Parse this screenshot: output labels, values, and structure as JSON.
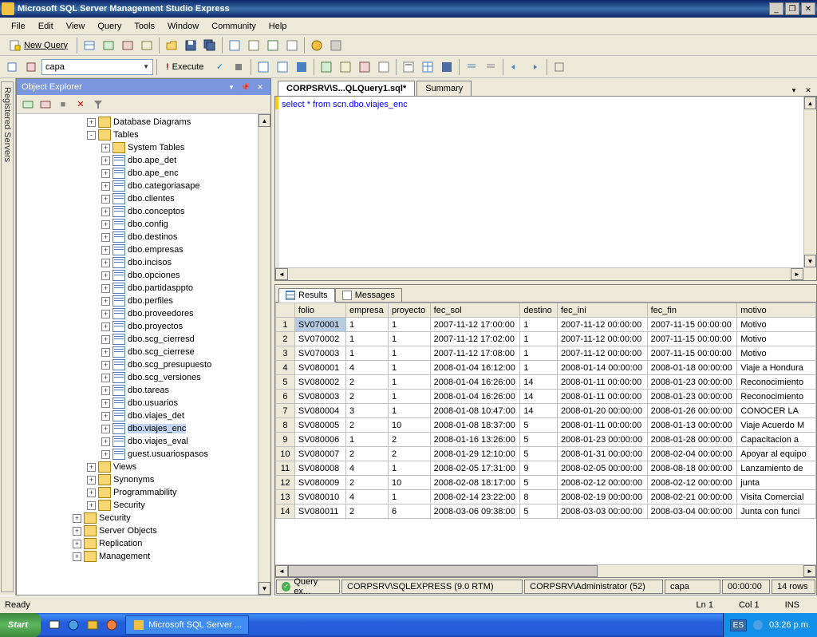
{
  "title": "Microsoft SQL Server Management Studio Express",
  "menu": [
    "File",
    "Edit",
    "View",
    "Query",
    "Tools",
    "Window",
    "Community",
    "Help"
  ],
  "newquery_label": "New Query",
  "db_combo": "capa",
  "execute_label": "Execute",
  "side_tab": "Registered Servers",
  "explorer_title": "Object Explorer",
  "tree": {
    "top": [
      {
        "label": "Database Diagrams",
        "kind": "folder",
        "toggle": "+",
        "ind": 2
      },
      {
        "label": "Tables",
        "kind": "folder",
        "toggle": "-",
        "ind": 2
      },
      {
        "label": "System Tables",
        "kind": "folder",
        "toggle": "+",
        "ind": 3
      },
      {
        "label": "dbo.ape_det",
        "kind": "table",
        "toggle": "+",
        "ind": 3
      },
      {
        "label": "dbo.ape_enc",
        "kind": "table",
        "toggle": "+",
        "ind": 3
      },
      {
        "label": "dbo.categoriasape",
        "kind": "table",
        "toggle": "+",
        "ind": 3
      },
      {
        "label": "dbo.clientes",
        "kind": "table",
        "toggle": "+",
        "ind": 3
      },
      {
        "label": "dbo.conceptos",
        "kind": "table",
        "toggle": "+",
        "ind": 3
      },
      {
        "label": "dbo.config",
        "kind": "table",
        "toggle": "+",
        "ind": 3
      },
      {
        "label": "dbo.destinos",
        "kind": "table",
        "toggle": "+",
        "ind": 3
      },
      {
        "label": "dbo.empresas",
        "kind": "table",
        "toggle": "+",
        "ind": 3
      },
      {
        "label": "dbo.incisos",
        "kind": "table",
        "toggle": "+",
        "ind": 3
      },
      {
        "label": "dbo.opciones",
        "kind": "table",
        "toggle": "+",
        "ind": 3
      },
      {
        "label": "dbo.partidasppto",
        "kind": "table",
        "toggle": "+",
        "ind": 3
      },
      {
        "label": "dbo.perfiles",
        "kind": "table",
        "toggle": "+",
        "ind": 3
      },
      {
        "label": "dbo.proveedores",
        "kind": "table",
        "toggle": "+",
        "ind": 3
      },
      {
        "label": "dbo.proyectos",
        "kind": "table",
        "toggle": "+",
        "ind": 3
      },
      {
        "label": "dbo.scg_cierresd",
        "kind": "table",
        "toggle": "+",
        "ind": 3
      },
      {
        "label": "dbo.scg_cierrese",
        "kind": "table",
        "toggle": "+",
        "ind": 3
      },
      {
        "label": "dbo.scg_presupuesto",
        "kind": "table",
        "toggle": "+",
        "ind": 3
      },
      {
        "label": "dbo.scg_versiones",
        "kind": "table",
        "toggle": "+",
        "ind": 3
      },
      {
        "label": "dbo.tareas",
        "kind": "table",
        "toggle": "+",
        "ind": 3
      },
      {
        "label": "dbo.usuarios",
        "kind": "table",
        "toggle": "+",
        "ind": 3
      },
      {
        "label": "dbo.viajes_det",
        "kind": "table",
        "toggle": "+",
        "ind": 3
      },
      {
        "label": "dbo.viajes_enc",
        "kind": "table",
        "toggle": "+",
        "ind": 3,
        "selected": true
      },
      {
        "label": "dbo.viajes_eval",
        "kind": "table",
        "toggle": "+",
        "ind": 3
      },
      {
        "label": "guest.usuariospasos",
        "kind": "table",
        "toggle": "+",
        "ind": 3
      },
      {
        "label": "Views",
        "kind": "folder",
        "toggle": "+",
        "ind": 2
      },
      {
        "label": "Synonyms",
        "kind": "folder",
        "toggle": "+",
        "ind": 2
      },
      {
        "label": "Programmability",
        "kind": "folder",
        "toggle": "+",
        "ind": 2
      },
      {
        "label": "Security",
        "kind": "folder",
        "toggle": "+",
        "ind": 2
      },
      {
        "label": "Security",
        "kind": "folder",
        "toggle": "+",
        "ind": 1
      },
      {
        "label": "Server Objects",
        "kind": "folder",
        "toggle": "+",
        "ind": 1
      },
      {
        "label": "Replication",
        "kind": "folder",
        "toggle": "+",
        "ind": 1
      },
      {
        "label": "Management",
        "kind": "folder",
        "toggle": "+",
        "ind": 1
      }
    ]
  },
  "tabs": {
    "active": "CORPSRV\\S...QLQuery1.sql*",
    "inactive": "Summary"
  },
  "sql": "select * from scn.dbo.viajes_enc",
  "results_tab": "Results",
  "messages_tab": "Messages",
  "columns": [
    "folio",
    "empresa",
    "proyecto",
    "fec_sol",
    "destino",
    "fec_ini",
    "fec_fin",
    "motivo"
  ],
  "rows": [
    [
      "SV070001",
      "1",
      "1",
      "2007-11-12 17:00:00",
      "1",
      "2007-11-12 00:00:00",
      "2007-11-15 00:00:00",
      "Motivo"
    ],
    [
      "SV070002",
      "1",
      "1",
      "2007-11-12 17:02:00",
      "1",
      "2007-11-12 00:00:00",
      "2007-11-15 00:00:00",
      "Motivo"
    ],
    [
      "SV070003",
      "1",
      "1",
      "2007-11-12 17:08:00",
      "1",
      "2007-11-12 00:00:00",
      "2007-11-15 00:00:00",
      "Motivo"
    ],
    [
      "SV080001",
      "4",
      "1",
      "2008-01-04 16:12:00",
      "1",
      "2008-01-14 00:00:00",
      "2008-01-18 00:00:00",
      "Viaje a Hondura"
    ],
    [
      "SV080002",
      "2",
      "1",
      "2008-01-04 16:26:00",
      "14",
      "2008-01-11 00:00:00",
      "2008-01-23 00:00:00",
      "Reconocimiento"
    ],
    [
      "SV080003",
      "2",
      "1",
      "2008-01-04 16:26:00",
      "14",
      "2008-01-11 00:00:00",
      "2008-01-23 00:00:00",
      "Reconocimiento"
    ],
    [
      "SV080004",
      "3",
      "1",
      "2008-01-08 10:47:00",
      "14",
      "2008-01-20 00:00:00",
      "2008-01-26 00:00:00",
      "CONOCER LA"
    ],
    [
      "SV080005",
      "2",
      "10",
      "2008-01-08 18:37:00",
      "5",
      "2008-01-11 00:00:00",
      "2008-01-13 00:00:00",
      "Viaje Acuerdo M"
    ],
    [
      "SV080006",
      "1",
      "2",
      "2008-01-16 13:26:00",
      "5",
      "2008-01-23 00:00:00",
      "2008-01-28 00:00:00",
      "Capacitacion a"
    ],
    [
      "SV080007",
      "2",
      "2",
      "2008-01-29 12:10:00",
      "5",
      "2008-01-31 00:00:00",
      "2008-02-04 00:00:00",
      "Apoyar al equipo"
    ],
    [
      "SV080008",
      "4",
      "1",
      "2008-02-05 17:31:00",
      "9",
      "2008-02-05 00:00:00",
      "2008-08-18 00:00:00",
      "Lanzamiento de"
    ],
    [
      "SV080009",
      "2",
      "10",
      "2008-02-08 18:17:00",
      "5",
      "2008-02-12 00:00:00",
      "2008-02-12 00:00:00",
      "junta"
    ],
    [
      "SV080010",
      "4",
      "1",
      "2008-02-14 23:22:00",
      "8",
      "2008-02-19 00:00:00",
      "2008-02-21 00:00:00",
      "Visita Comercial"
    ],
    [
      "SV080011",
      "2",
      "6",
      "2008-03-06 09:38:00",
      "5",
      "2008-03-03 00:00:00",
      "2008-03-04 00:00:00",
      "Junta con funci"
    ]
  ],
  "status": {
    "query": "Query ex...",
    "server": "CORPSRV\\SQLEXPRESS (9.0 RTM)",
    "user": "CORPSRV\\Administrator (52)",
    "db": "capa",
    "time": "00:00:00",
    "rows": "14 rows"
  },
  "bottomstatus": {
    "ready": "Ready",
    "ln": "Ln 1",
    "col": "Col 1",
    "ins": "INS"
  },
  "taskbar": {
    "start": "Start",
    "task": "Microsoft SQL Server ...",
    "lang": "ES",
    "clock": "03:26 p.m."
  }
}
